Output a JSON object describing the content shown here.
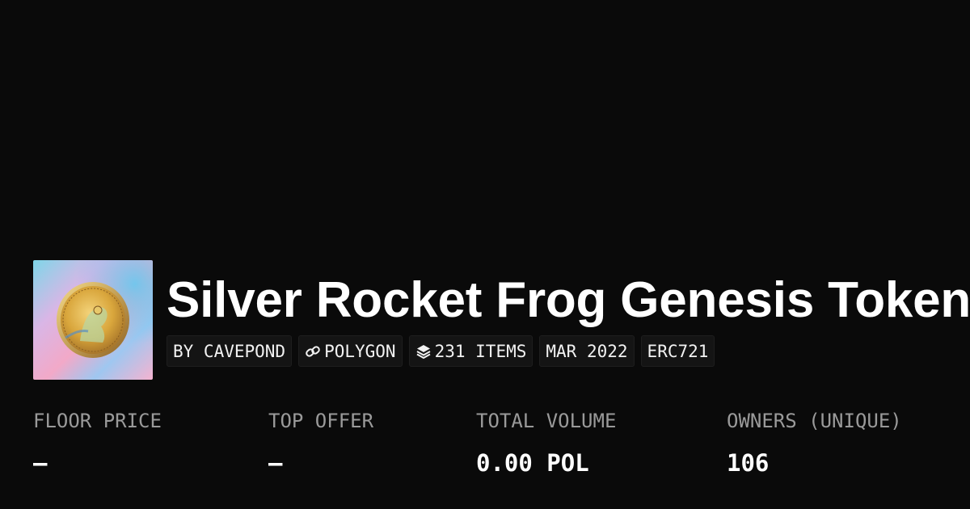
{
  "collection": {
    "title": "Silver Rocket Frog Genesis Token",
    "image_alt": "collection-coin-image"
  },
  "tags": {
    "creator": "BY CAVEPOND",
    "chain": "POLYGON",
    "chain_icon": "link-icon",
    "items": "231 ITEMS",
    "items_icon": "layers-icon",
    "date": "MAR 2022",
    "standard": "ERC721"
  },
  "stats": {
    "floor_price": {
      "label": "FLOOR PRICE",
      "value": "–"
    },
    "top_offer": {
      "label": "TOP OFFER",
      "value": "–"
    },
    "total_volume": {
      "label": "TOTAL VOLUME",
      "value": "0.00 POL"
    },
    "owners": {
      "label": "OWNERS (UNIQUE)",
      "value": "106"
    }
  },
  "colors": {
    "background": "#0a0a0a",
    "tag_background": "#141414",
    "label_gray": "#9a9a9a",
    "text": "#ffffff"
  }
}
